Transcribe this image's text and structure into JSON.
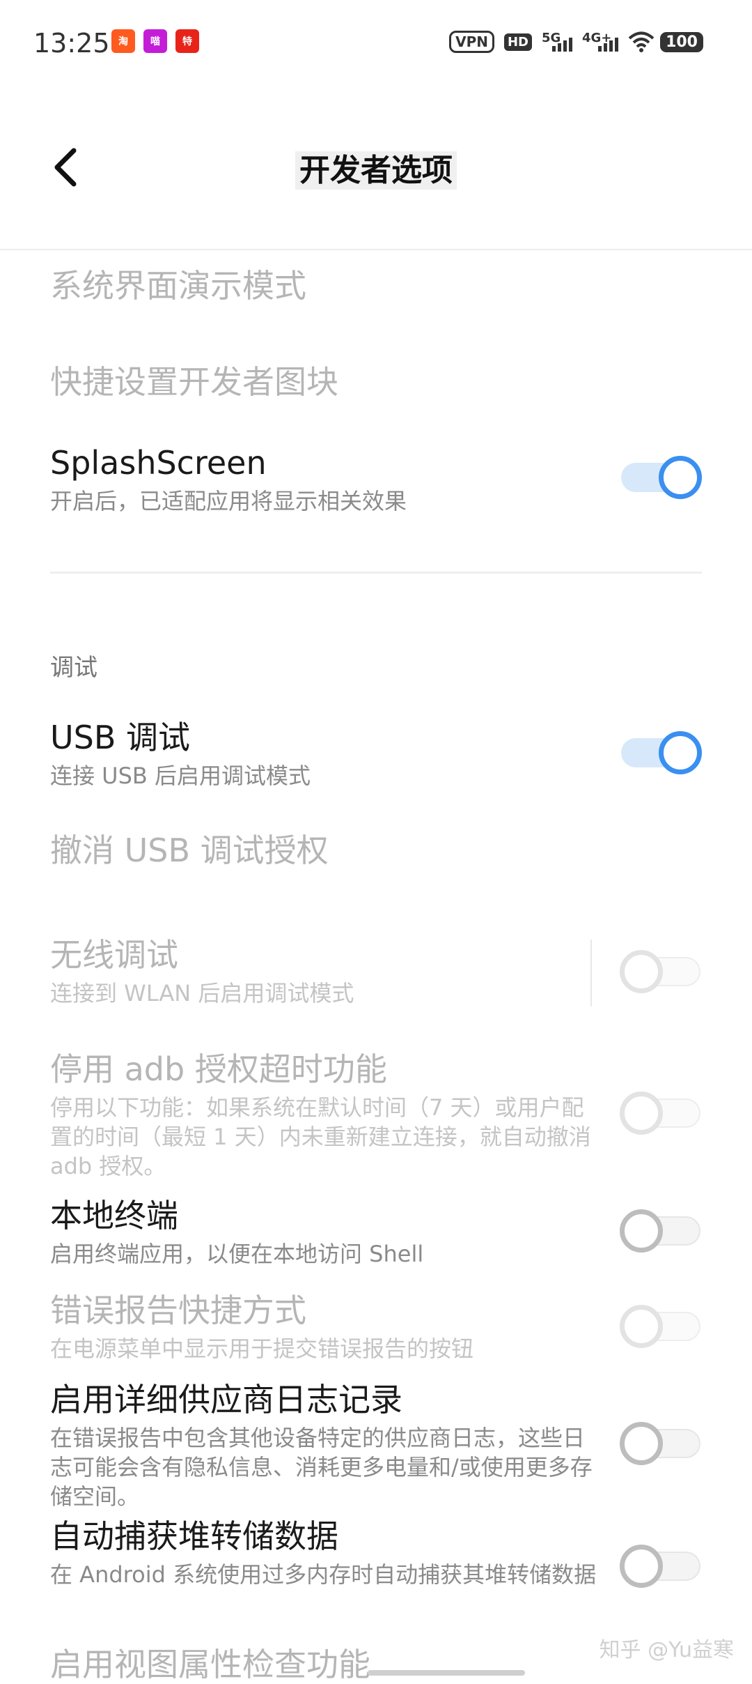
{
  "status_bar": {
    "time": "13:25",
    "apps": [
      {
        "icon": "taobao-app-icon",
        "glyph": "淘",
        "color": "#ff5a1f"
      },
      {
        "icon": "tmall-app-icon",
        "glyph": "喵",
        "color": "#c41dd8"
      },
      {
        "icon": "deal-app-icon",
        "glyph": "特",
        "color": "#e8241a"
      }
    ],
    "vpn": "VPN",
    "hd": "HD",
    "net_5g": "5G",
    "net_4g": "4G+",
    "battery": "100"
  },
  "header": {
    "title": "开发者选项"
  },
  "items": {
    "demo_mode": {
      "title": "系统界面演示模式"
    },
    "qs_tiles": {
      "title": "快捷设置开发者图块"
    },
    "splash": {
      "title": "SplashScreen",
      "subtitle": "开启后，已适配应用将显示相关效果"
    },
    "section_debug": "调试",
    "usb_debug": {
      "title": "USB 调试",
      "subtitle": "连接 USB 后启用调试模式"
    },
    "revoke_usb": {
      "title": "撤消 USB 调试授权"
    },
    "wireless_debug": {
      "title": "无线调试",
      "subtitle": "连接到 WLAN 后启用调试模式"
    },
    "adb_timeout": {
      "title": "停用 adb 授权超时功能",
      "subtitle": "停用以下功能：如果系统在默认时间（7 天）或用户配置的时间（最短 1 天）内未重新建立连接，就自动撤消 adb 授权。"
    },
    "local_terminal": {
      "title": "本地终端",
      "subtitle": "启用终端应用，以便在本地访问 Shell"
    },
    "bug_report": {
      "title": "错误报告快捷方式",
      "subtitle": "在电源菜单中显示用于提交错误报告的按钮"
    },
    "vendor_log": {
      "title": "启用详细供应商日志记录",
      "subtitle": "在错误报告中包含其他设备特定的供应商日志，这些日志可能会含有隐私信息、消耗更多电量和/或使用更多存储空间。"
    },
    "heap_dump": {
      "title": "自动捕获堆转储数据",
      "subtitle": "在 Android 系统使用过多内存时自动捕获其堆转储数据"
    },
    "view_attr": {
      "title": "启用视图属性检查功能"
    }
  },
  "watermark": "知乎 @Yu益寒"
}
